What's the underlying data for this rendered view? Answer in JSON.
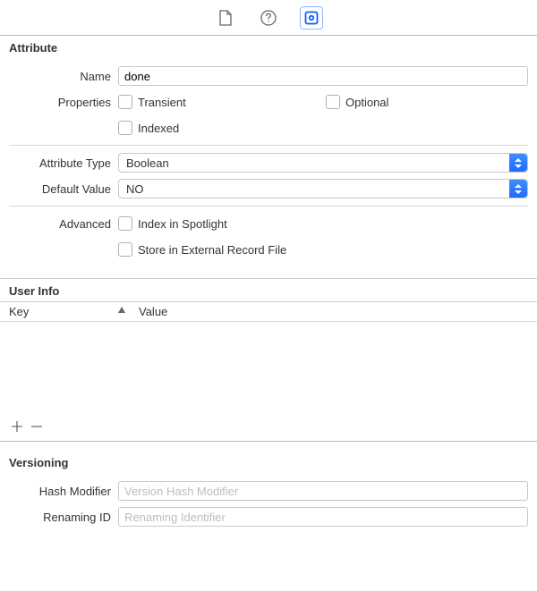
{
  "sections": {
    "attribute": "Attribute",
    "user_info": "User Info",
    "versioning": "Versioning"
  },
  "attribute": {
    "name_label": "Name",
    "name_value": "done",
    "properties_label": "Properties",
    "transient": "Transient",
    "optional": "Optional",
    "indexed": "Indexed",
    "type_label": "Attribute Type",
    "type_value": "Boolean",
    "default_label": "Default Value",
    "default_value": "NO",
    "advanced_label": "Advanced",
    "spotlight": "Index in Spotlight",
    "external_record": "Store in External Record File"
  },
  "userinfo": {
    "key_header": "Key",
    "value_header": "Value"
  },
  "versioning": {
    "hash_label": "Hash Modifier",
    "hash_placeholder": "Version Hash Modifier",
    "rename_label": "Renaming ID",
    "rename_placeholder": "Renaming Identifier"
  }
}
